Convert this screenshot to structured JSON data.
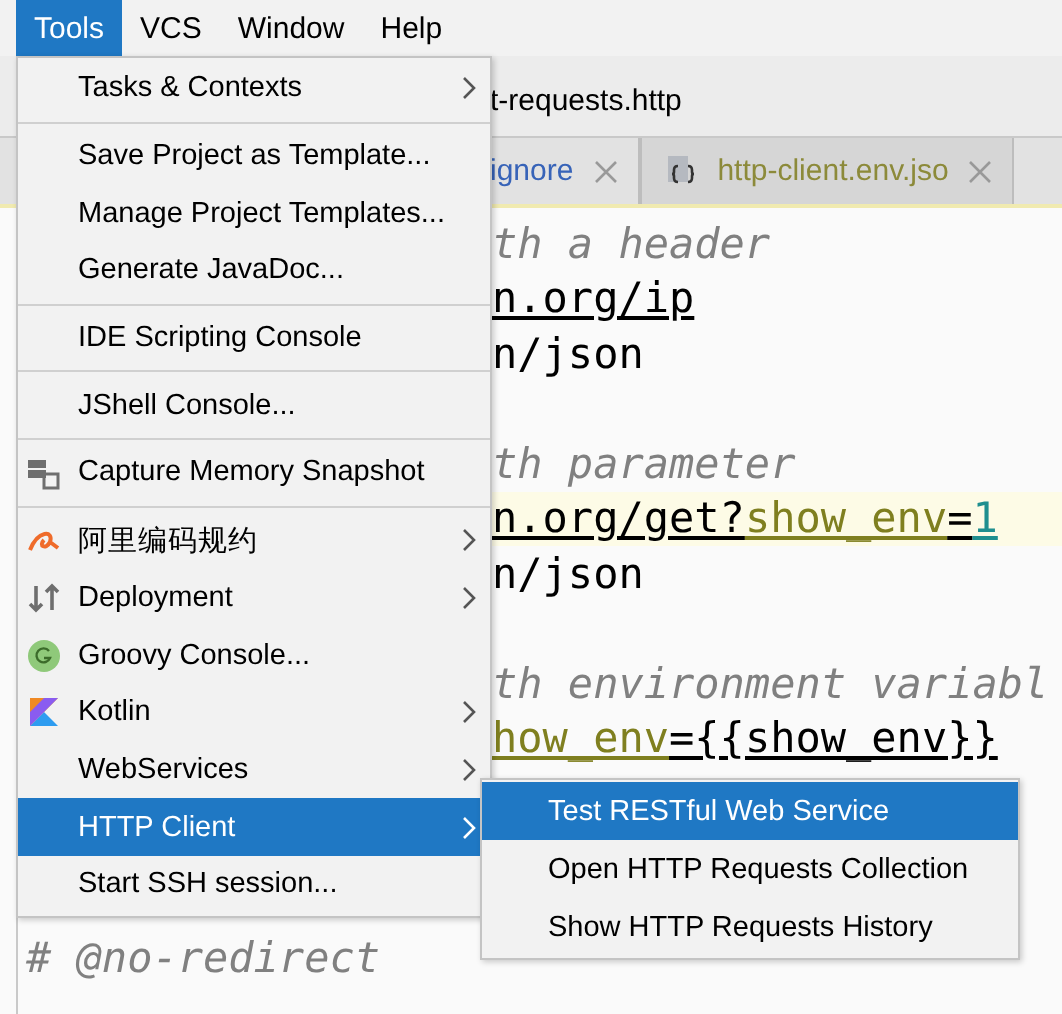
{
  "menubar": [
    {
      "label": "Tools",
      "selected": true
    },
    {
      "label": "VCS",
      "selected": false
    },
    {
      "label": "Window",
      "selected": false
    },
    {
      "label": "Help",
      "selected": false
    }
  ],
  "breadcrumb": {
    "file": "t-requests.http"
  },
  "tabs": [
    {
      "label": "ignore",
      "kind": "ignore",
      "selected": false
    },
    {
      "label": "http-client.env.jso",
      "kind": "json",
      "selected": true
    }
  ],
  "editor": {
    "lines": [
      {
        "kind": "tail",
        "segments": [
          {
            "text": "th a header",
            "kind": "comment"
          }
        ]
      },
      {
        "kind": "tail",
        "segments": [
          {
            "text": "n.org/ip",
            "kind": "url"
          }
        ]
      },
      {
        "kind": "tail",
        "segments": [
          {
            "text": "n/json",
            "kind": "plain"
          }
        ]
      },
      {
        "kind": "blank"
      },
      {
        "kind": "tail",
        "segments": [
          {
            "text": "th parameter",
            "kind": "comment"
          }
        ]
      },
      {
        "kind": "tail",
        "current": true,
        "segments": [
          {
            "text": "n.org/get?",
            "kind": "url"
          },
          {
            "text": "show_env",
            "kind": "key"
          },
          {
            "text": "=",
            "kind": "url"
          },
          {
            "text": "1",
            "kind": "number"
          }
        ]
      },
      {
        "kind": "tail",
        "segments": [
          {
            "text": "n/json",
            "kind": "plain"
          }
        ]
      },
      {
        "kind": "blank"
      },
      {
        "kind": "tail",
        "segments": [
          {
            "text": "th environment variabl",
            "kind": "comment"
          }
        ]
      },
      {
        "kind": "tail",
        "segments": [
          {
            "text": "how_env",
            "kind": "key"
          },
          {
            "text": "={{show_env}}",
            "kind": "url"
          }
        ]
      },
      {
        "kind": "blank"
      },
      {
        "kind": "blank"
      },
      {
        "kind": "blank"
      },
      {
        "kind": "code",
        "segments": [
          {
            "text": "# @no-redirect",
            "kind": "comment"
          }
        ]
      }
    ]
  },
  "menu": {
    "items": [
      {
        "kind": "item",
        "label": "Tasks & Contexts",
        "submenu": true,
        "selected": false
      },
      {
        "kind": "separator"
      },
      {
        "kind": "item",
        "label": "Save Project as Template...",
        "submenu": false,
        "selected": false
      },
      {
        "kind": "item",
        "label": "Manage Project Templates...",
        "submenu": false,
        "selected": false
      },
      {
        "kind": "item",
        "label": "Generate JavaDoc...",
        "submenu": false,
        "selected": false
      },
      {
        "kind": "separator"
      },
      {
        "kind": "item",
        "label": "IDE Scripting Console",
        "submenu": false,
        "selected": false
      },
      {
        "kind": "separator"
      },
      {
        "kind": "item",
        "label": "JShell Console...",
        "submenu": false,
        "selected": false
      },
      {
        "kind": "separator"
      },
      {
        "kind": "item",
        "label": "Capture Memory Snapshot",
        "submenu": false,
        "selected": false
      },
      {
        "kind": "separator"
      },
      {
        "kind": "item",
        "label": "阿里编码规约",
        "submenu": true,
        "selected": false
      },
      {
        "kind": "item",
        "label": "Deployment",
        "submenu": true,
        "selected": false
      },
      {
        "kind": "item",
        "label": "Groovy Console...",
        "submenu": false,
        "selected": false
      },
      {
        "kind": "item",
        "label": "Kotlin",
        "submenu": true,
        "selected": false
      },
      {
        "kind": "item",
        "label": "WebServices",
        "submenu": true,
        "selected": false
      },
      {
        "kind": "item",
        "label": "HTTP Client",
        "submenu": true,
        "selected": true
      },
      {
        "kind": "item",
        "label": "Start SSH session...",
        "submenu": false,
        "selected": false
      }
    ]
  },
  "submenu": {
    "items": [
      {
        "label": "Test RESTful Web Service",
        "selected": true
      },
      {
        "label": "Open HTTP Requests Collection",
        "selected": false
      },
      {
        "label": "Show HTTP Requests History",
        "selected": false
      }
    ]
  }
}
